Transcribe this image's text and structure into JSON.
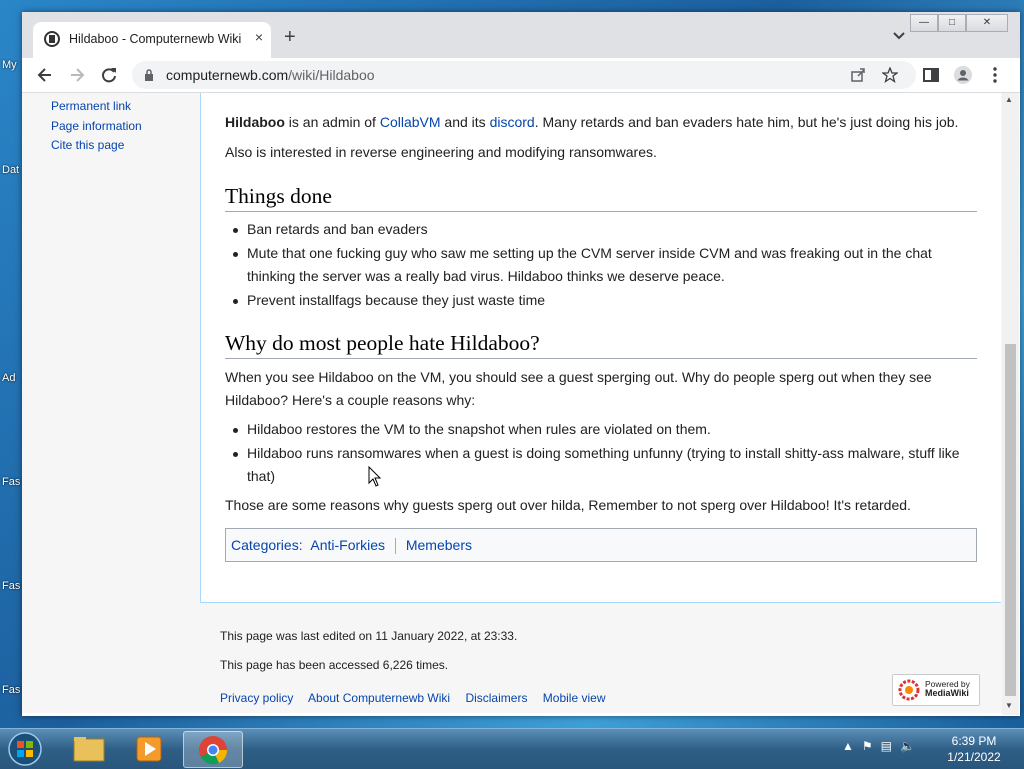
{
  "desktop": {
    "icon_labels": [
      "My",
      "Dat",
      "Ad",
      "Fas",
      "Fas",
      "Fas"
    ]
  },
  "browser": {
    "tab_title": "Hildaboo - Computernewb Wiki",
    "tab_close": "×",
    "new_tab": "+",
    "url_host": "computernewb.com",
    "url_path": "/wiki/Hildaboo",
    "window_buttons": {
      "minimize": "—",
      "maximize": "□",
      "close": "✕"
    }
  },
  "sidebar": {
    "links": [
      "Permanent link",
      "Page information",
      "Cite this page"
    ]
  },
  "article": {
    "intro_bold": "Hildaboo",
    "intro_1": " is an admin of ",
    "link_collabvm": "CollabVM",
    "intro_2": " and its ",
    "link_discord": "discord",
    "intro_3": ". Many retards and ban evaders hate him, but he's just doing his job.",
    "intro_para2": "Also is interested in reverse engineering and modifying ransomwares.",
    "h_things_done": "Things done",
    "things_done": [
      "Ban retards and ban evaders",
      "Mute that one fucking guy who saw me setting up the CVM server inside CVM and was freaking out in the chat thinking the server was a really bad virus. Hildaboo thinks we deserve peace.",
      "Prevent installfags because they just waste time"
    ],
    "h_why_hate": "Why do most people hate Hildaboo?",
    "why_para": "When you see Hildaboo on the VM, you should see a guest sperging out. Why do people sperg out when they see Hildaboo? Here's a couple reasons why:",
    "reasons": [
      "Hildaboo restores the VM to the snapshot when rules are violated on them.",
      "Hildaboo runs ransomwares when a guest is doing something unfunny (trying to install shitty-ass malware, stuff like that)"
    ],
    "closing_para": "Those are some reasons why guests sperg out over hilda, Remember to not sperg over Hildaboo! It's retarded.",
    "categories_label": "Categories",
    "categories": [
      "Anti-Forkies",
      "Memebers"
    ]
  },
  "footer": {
    "last_edited": "This page was last edited on 11 January 2022, at 23:33.",
    "accessed": "This page has been accessed 6,226 times.",
    "links": [
      "Privacy policy",
      "About Computernewb Wiki",
      "Disclaimers",
      "Mobile view"
    ],
    "powered_by_line1": "Powered by",
    "powered_by_line2": "MediaWiki"
  },
  "taskbar": {
    "time": "6:39 PM",
    "date": "1/21/2022"
  },
  "colors": {
    "link": "#0645ad",
    "taskbar": "#2f5f86",
    "chrome_tabstrip": "#dfe1e5"
  }
}
